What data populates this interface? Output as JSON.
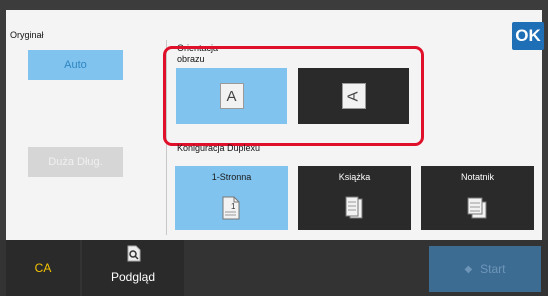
{
  "panel": {
    "original_label": "Oryginał",
    "auto_button": "Auto",
    "duza_button": "Duża Dług.",
    "orientation_label_1": "Orientacja",
    "orientation_label_2": "obrazu",
    "orientation_options": [
      "A",
      "A"
    ],
    "duplex_label": "Konigur‍acja Duplexu",
    "duplex_options": [
      {
        "label": "1-Stronna",
        "selected": true
      },
      {
        "label": "Książka",
        "selected": false
      },
      {
        "label": "Notatnik",
        "selected": false
      }
    ],
    "ok_button": "OK"
  },
  "bottom_bar": {
    "ca_button": "CA",
    "preview_button": "Podgląd",
    "start_button": "Start"
  },
  "colors": {
    "selected_blue": "#7fc3ee",
    "dark_button": "#2a2a2a",
    "highlight_red": "#e0102a",
    "ok_blue": "#1f6fb7"
  }
}
